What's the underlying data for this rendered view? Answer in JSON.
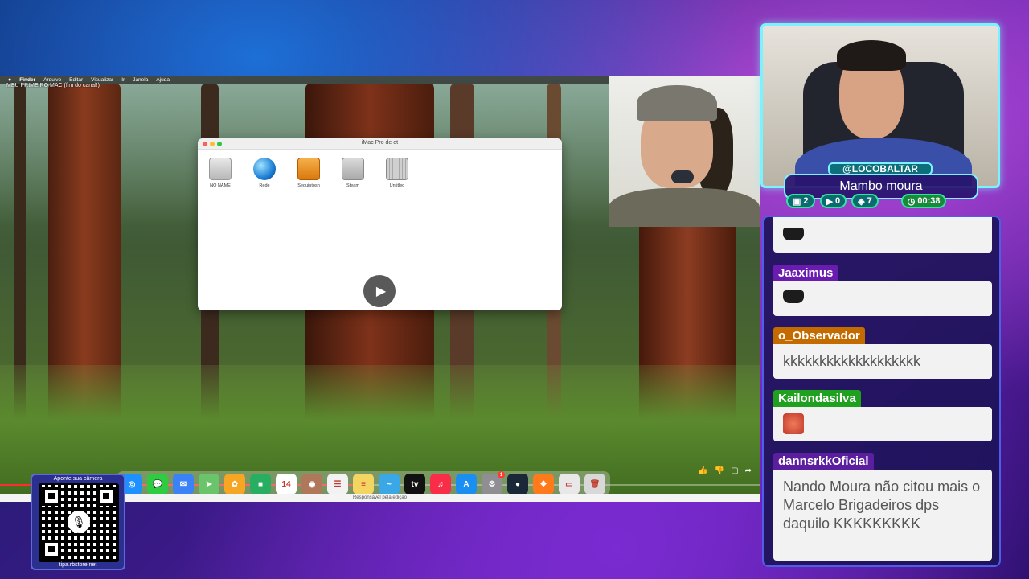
{
  "video": {
    "title": "MEU PRIMEIRO MAC (fim do canal!)",
    "menubar": {
      "apple": "",
      "items": [
        "Finder",
        "Arquivo",
        "Editar",
        "Visualizar",
        "Ir",
        "Janela",
        "Ajuda"
      ]
    },
    "finder": {
      "title": "iMac Pro de et",
      "drives": [
        {
          "label": "NO NAME",
          "icon": "hd"
        },
        {
          "label": "Rede",
          "icon": "net"
        },
        {
          "label": "Sequintosh",
          "icon": "orange"
        },
        {
          "label": "Steam",
          "icon": "gray"
        },
        {
          "label": "Untitled",
          "icon": "grid"
        }
      ]
    },
    "play_icon": "▶",
    "caption": "Responsável pela edição",
    "progress": 0.47,
    "dock": [
      {
        "name": "safari",
        "color": "#1e90ff",
        "glyph": "◎"
      },
      {
        "name": "messages",
        "color": "#2ecc40",
        "glyph": "💬"
      },
      {
        "name": "mail",
        "color": "#3b82f6",
        "glyph": "✉"
      },
      {
        "name": "maps",
        "color": "#6ac46a",
        "glyph": "➤"
      },
      {
        "name": "photos",
        "color": "#f6a623",
        "glyph": "✿"
      },
      {
        "name": "facetime",
        "color": "#27ae60",
        "glyph": "■"
      },
      {
        "name": "calendar",
        "color": "#ffffff",
        "glyph": "14"
      },
      {
        "name": "contacts",
        "color": "#b0785a",
        "glyph": "◉"
      },
      {
        "name": "reminders",
        "color": "#f2f2f2",
        "glyph": "☰"
      },
      {
        "name": "notes",
        "color": "#f5d562",
        "glyph": "≡"
      },
      {
        "name": "freeform",
        "color": "#3aa7e6",
        "glyph": "~"
      },
      {
        "name": "tv",
        "color": "#111111",
        "glyph": "tv"
      },
      {
        "name": "music",
        "color": "#fa2d48",
        "glyph": "♫"
      },
      {
        "name": "appstore",
        "color": "#1b8ef2",
        "glyph": "A"
      },
      {
        "name": "settings",
        "color": "#8e8e93",
        "glyph": "⚙",
        "badge": "1"
      },
      {
        "name": "steam",
        "color": "#1b2838",
        "glyph": "●"
      },
      {
        "name": "fl-studio",
        "color": "#ff7a1a",
        "glyph": "❖"
      },
      {
        "name": "finder-doc",
        "color": "#e8e8e8",
        "glyph": "▭"
      },
      {
        "name": "trash",
        "color": "#d8d8d8",
        "glyph": "🗑"
      }
    ]
  },
  "stream": {
    "handle": "@LOCOBALTAR",
    "subname": "Mambo moura",
    "stats": [
      {
        "icon": "twitch-icon",
        "value": "2"
      },
      {
        "icon": "youtube-icon",
        "value": "0"
      },
      {
        "icon": "kick-icon",
        "value": "7"
      },
      {
        "icon": "clock-icon",
        "value": "00:38"
      }
    ]
  },
  "chat": {
    "messages": [
      {
        "user": "",
        "user_color": "",
        "text": "",
        "emote": "hat"
      },
      {
        "user": "Jaaximus",
        "user_color": "#6a1bb0",
        "text": "",
        "emote": "hat"
      },
      {
        "user": "o_Observador",
        "user_color": "#c46b00",
        "text": "kkkkkkkkkkkkkkkkkkk",
        "emote": ""
      },
      {
        "user": "Kailondasilva",
        "user_color": "#1fa01f",
        "text": "",
        "emote": "face"
      },
      {
        "user": "dannsrkkOficial",
        "user_color": "#5a1e9e",
        "text": "Nando Moura não citou mais o Marcelo Brigadeiros dps daquilo KKKKKKKKK",
        "emote": ""
      }
    ]
  },
  "qr": {
    "title": "Aponte sua câmera",
    "url": "tipa.rbstore.net"
  }
}
